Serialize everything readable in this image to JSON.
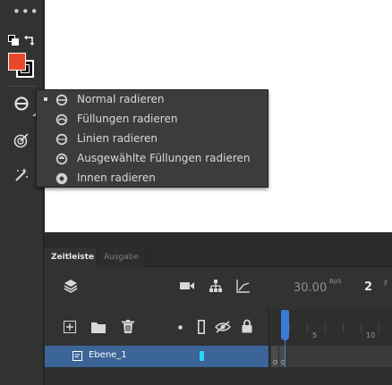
{
  "toolbar": {
    "more_label": "•••",
    "tools": [
      {
        "name": "eraser-tool",
        "icon": "eraser-icon"
      },
      {
        "name": "target-tool",
        "icon": "target-icon"
      },
      {
        "name": "magic-wand-tool",
        "icon": "magic-wand-icon"
      }
    ],
    "fill_color": "#e8482a",
    "stroke_color": "#000000"
  },
  "eraser_menu": {
    "items": [
      {
        "label": "Normal radieren",
        "icon": "erase-normal-icon",
        "selected": true
      },
      {
        "label": "Füllungen radieren",
        "icon": "erase-fills-icon",
        "selected": false
      },
      {
        "label": "Linien radieren",
        "icon": "erase-lines-icon",
        "selected": false
      },
      {
        "label": "Ausgewählte Füllungen radieren",
        "icon": "erase-selected-fills-icon",
        "selected": false
      },
      {
        "label": "Innen radieren",
        "icon": "erase-inside-icon",
        "selected": false
      }
    ]
  },
  "timeline": {
    "tabs": [
      {
        "label": "Zeitleiste",
        "active": true
      },
      {
        "label": "Ausgabe",
        "active": false
      }
    ],
    "fps_value": "30.00",
    "fps_unit": "BpS",
    "current_frame": "2",
    "frame_unit": "F",
    "ruler_labels": [
      "5",
      "10"
    ],
    "layers": [
      {
        "name": "Ebene_1",
        "color": "#27d4f4",
        "selected": true
      }
    ],
    "accent_color": "#3a7ad6"
  }
}
